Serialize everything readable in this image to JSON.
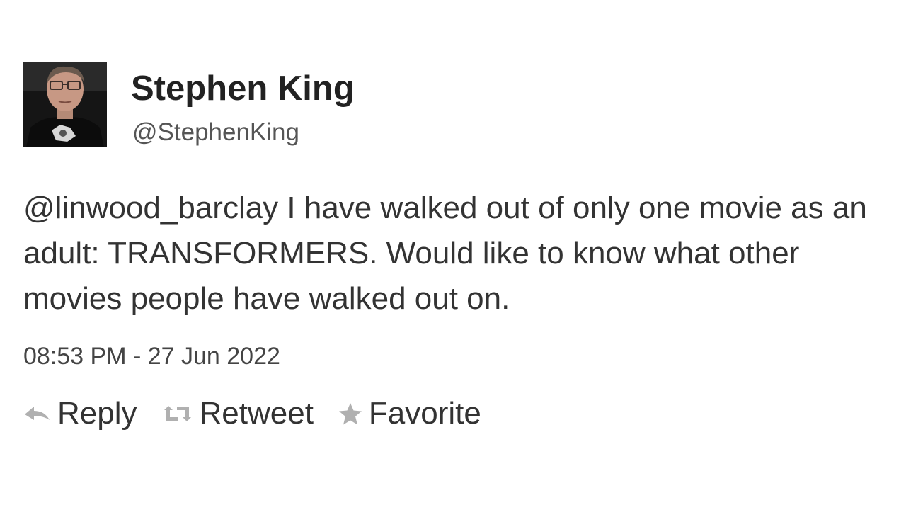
{
  "author": {
    "display_name": "Stephen King",
    "handle": "@StephenKing"
  },
  "tweet": {
    "mention": "@linwood_barclay",
    "body": " I have walked out of only one movie as an adult: TRANSFORMERS. Would like to know what other movies people have walked out on.",
    "timestamp": "08:53 PM - 27 Jun 2022"
  },
  "actions": {
    "reply": {
      "label": "Reply",
      "icon": "reply-arrow-icon"
    },
    "retweet": {
      "label": "Retweet",
      "icon": "retweet-icon"
    },
    "favorite": {
      "label": "Favorite",
      "icon": "star-icon"
    }
  },
  "colors": {
    "text": "#333333",
    "icon_gray": "#aaaaaa"
  }
}
